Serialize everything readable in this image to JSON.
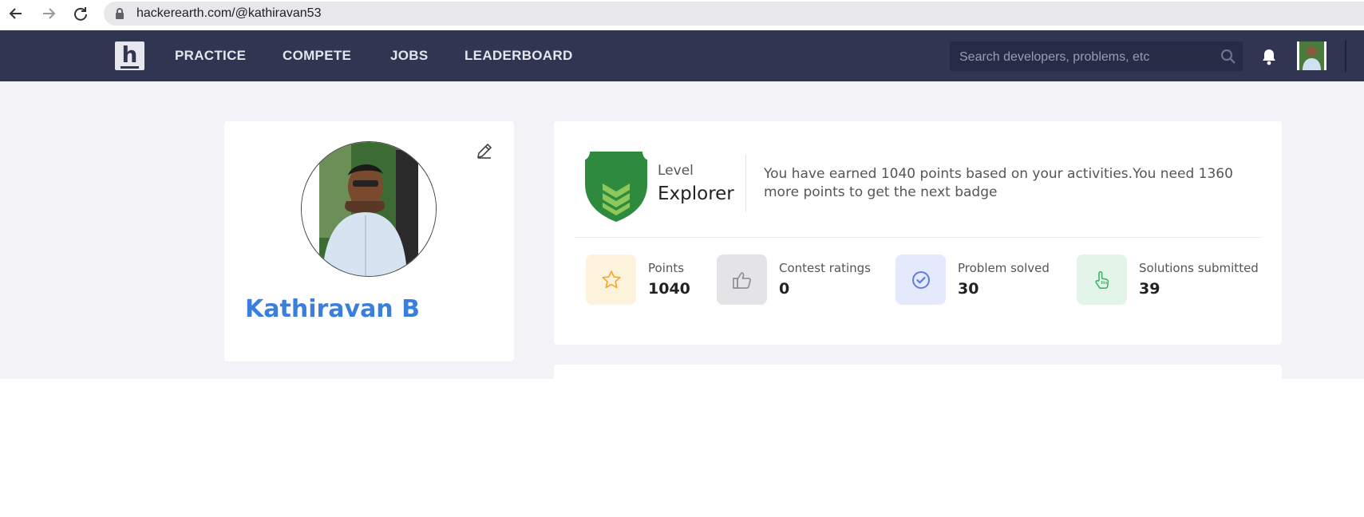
{
  "browser": {
    "url": "hackerearth.com/@kathiravan53",
    "icons": [
      "back-arrow-icon",
      "forward-arrow-icon",
      "reload-icon",
      "lock-icon"
    ]
  },
  "nav": {
    "links": [
      {
        "label": "PRACTICE"
      },
      {
        "label": "COMPETE"
      },
      {
        "label": "JOBS"
      },
      {
        "label": "LEADERBOARD"
      }
    ],
    "search": {
      "placeholder": "Search developers, problems, etc"
    },
    "logo_letter": "h"
  },
  "profile": {
    "name": "Kathiravan B"
  },
  "level": {
    "label": "Level",
    "name": "Explorer",
    "message": "You have earned 1040 points based on your activities.You need 1360 more points to get the next badge"
  },
  "stats": [
    {
      "label": "Points",
      "value": "1040",
      "icon": "star-icon",
      "color": "#f5a623"
    },
    {
      "label": "Contest ratings",
      "value": "0",
      "icon": "thumbs-up-icon",
      "color": "#8a8a8a"
    },
    {
      "label": "Problem solved",
      "value": "30",
      "icon": "check-circle-icon",
      "color": "#5b7fe0"
    },
    {
      "label": "Solutions submitted",
      "value": "39",
      "icon": "hand-pointer-icon",
      "color": "#3fb36b"
    }
  ],
  "colors": {
    "nav_bg": "#303552",
    "accent_name": "#3b7fdc",
    "badge_green": "#2e8b3e"
  }
}
